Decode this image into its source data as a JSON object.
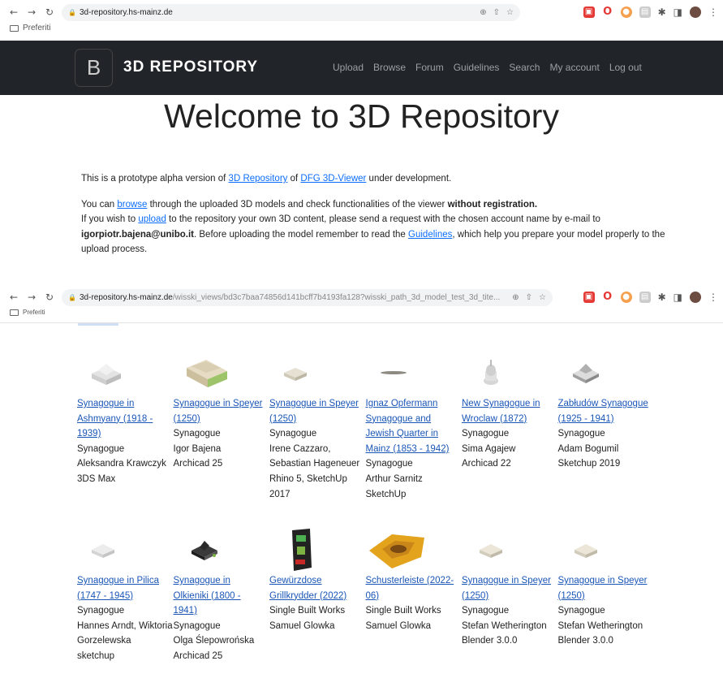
{
  "browser1": {
    "host": "3d-repository.hs-mainz.de",
    "path": "",
    "bookmark": "Preferiti"
  },
  "browser2": {
    "host": "3d-repository.hs-mainz.de",
    "path": "/wisski_views/bd3c7baa74856d141bcff7b4193fa128?wisski_path_3d_model_test_3d_tite...",
    "bookmark": "Preferiti"
  },
  "navbar": {
    "logo_letter": "B",
    "brand": "3D REPOSITORY",
    "links": [
      "Upload",
      "Browse",
      "Forum",
      "Guidelines",
      "Search",
      "My account",
      "Log out"
    ]
  },
  "welcome_title": "Welcome to 3D Repository",
  "intro": {
    "p1_a": "This is a prototype alpha version of ",
    "p1_link1": "3D Repository",
    "p1_b": " of ",
    "p1_link2": "DFG 3D-Viewer",
    "p1_c": " under development.",
    "p2_a": "You can ",
    "p2_link_browse": "browse",
    "p2_b": " through the uploaded 3D models and check functionalities of the viewer ",
    "p2_bold": "without registration.",
    "p2_c": "If you wish to ",
    "p2_link_upload": "upload",
    "p2_d": " to the repository your own 3D content, please send a request with the chosen account name by e-mail to ",
    "p2_email": "igorpiotr.bajena@unibo.it",
    "p2_e": ". Before uploading the model remember to read the ",
    "p2_link_guidelines": "Guidelines",
    "p2_f": ", which help you prepare your model properly to the upload process."
  },
  "models_row1": [
    {
      "title": "Synagogue in Ashmyany (1918 - 1939)",
      "type": "Synagogue",
      "author": "Aleksandra Krawczyk",
      "software": "3DS Max",
      "thumb": "white-block"
    },
    {
      "title": "Synagogue in Speyer (1250)",
      "type": "Synagogue",
      "author": "Igor Bajena",
      "software": "Archicad 25",
      "thumb": "green-block"
    },
    {
      "title": "Synagogue in Speyer (1250)",
      "type": "Synagogue",
      "author": "Irene Cazzaro, Sebastian Hageneuer",
      "software": "Rhino 5, SketchUp 2017",
      "thumb": "white-block"
    },
    {
      "title": "Ignaz Opfermann Synagogue and Jewish Quarter in Mainz (1853 - 1942)",
      "type": "Synagogue",
      "author": "Arthur Sarnitz",
      "software": "SketchUp",
      "thumb": "flat"
    },
    {
      "title": "New Synagogue in Wroclaw (1872)",
      "type": "Synagogue",
      "author": "Sima Agajew",
      "software": "Archicad 22",
      "thumb": "dome"
    },
    {
      "title": "Zabłudów Synagogue (1925 - 1941)",
      "type": "Synagogue",
      "author": "Adam Bogumil",
      "software": "Sketchup 2019",
      "thumb": "white-block"
    }
  ],
  "models_row2": [
    {
      "title": "Synagogue in Pilica (1747 - 1945)",
      "type": "Synagogue",
      "author": "Hannes Arndt, Wiktoria Gorzelewska",
      "software": "sketchup",
      "thumb": "white-block"
    },
    {
      "title": "Synagogue in Olkieniki (1800 - 1941)",
      "type": "Synagogue",
      "author": "Olga Ślepowrońska",
      "software": "Archicad 25",
      "thumb": "dark-block"
    },
    {
      "title": "Gewürzdose Grillkrydder (2022)",
      "type": "Single Built Works",
      "author": "Samuel Glowka",
      "software": "",
      "thumb": "spice-box"
    },
    {
      "title": "Schusterleiste (2022-06)",
      "type": "Single Built Works",
      "author": "Samuel Glowka",
      "software": "",
      "thumb": "gold-scan"
    },
    {
      "title": "Synagogue in Speyer (1250)",
      "type": "Synagogue",
      "author": "Stefan Wetherington",
      "software": "Blender 3.0.0",
      "thumb": "white-block"
    },
    {
      "title": "Synagogue in Speyer (1250)",
      "type": "Synagogue",
      "author": "Stefan Wetherington",
      "software": "Blender 3.0.0",
      "thumb": "white-block"
    }
  ]
}
